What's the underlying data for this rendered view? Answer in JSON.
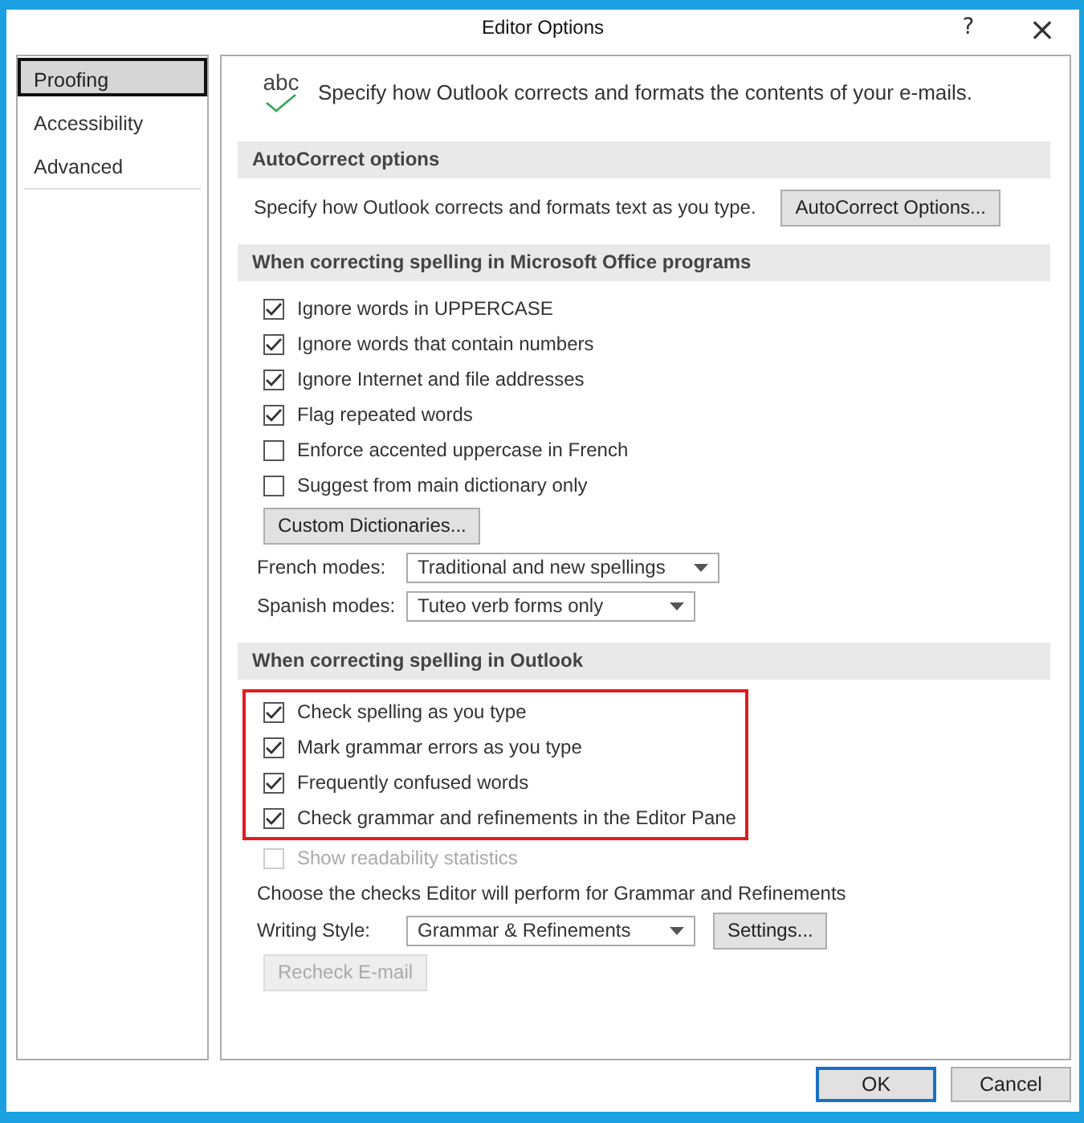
{
  "window": {
    "title": "Editor Options",
    "help": "?",
    "close": "×"
  },
  "sidebar": {
    "items": [
      {
        "label": "Proofing",
        "selected": true
      },
      {
        "label": "Accessibility",
        "selected": false
      },
      {
        "label": "Advanced",
        "selected": false
      }
    ]
  },
  "intro": {
    "icon_text": "abc",
    "text": "Specify how Outlook corrects and formats the contents of your e-mails."
  },
  "sections": [
    {
      "title": "AutoCorrect options",
      "items": [
        {
          "kind": "text_button",
          "text": "Specify how Outlook corrects and formats text as you type.",
          "button": "AutoCorrect Options..."
        }
      ]
    },
    {
      "title": "When correcting spelling in Microsoft Office programs",
      "items": [
        {
          "kind": "checkbox",
          "label": "Ignore words in UPPERCASE",
          "checked": true,
          "disabled": false,
          "highlighted": false
        },
        {
          "kind": "checkbox",
          "label": "Ignore words that contain numbers",
          "checked": true,
          "disabled": false,
          "highlighted": false
        },
        {
          "kind": "checkbox",
          "label": "Ignore Internet and file addresses",
          "checked": true,
          "disabled": false,
          "highlighted": false
        },
        {
          "kind": "checkbox",
          "label": "Flag repeated words",
          "checked": true,
          "disabled": false,
          "highlighted": false
        },
        {
          "kind": "checkbox",
          "label": "Enforce accented uppercase in French",
          "checked": false,
          "disabled": false,
          "highlighted": false
        },
        {
          "kind": "checkbox",
          "label": "Suggest from main dictionary only",
          "checked": false,
          "disabled": false,
          "highlighted": false
        },
        {
          "kind": "button",
          "label": "Custom Dictionaries...",
          "disabled": false
        },
        {
          "kind": "dropdown",
          "label": "French modes:",
          "value": "Traditional and new spellings"
        },
        {
          "kind": "dropdown",
          "label": "Spanish modes:",
          "value": "Tuteo verb forms only"
        }
      ]
    },
    {
      "title": "When correcting spelling in Outlook",
      "items": [
        {
          "kind": "checkbox",
          "label": "Check spelling as you type",
          "checked": true,
          "disabled": false,
          "highlighted": true
        },
        {
          "kind": "checkbox",
          "label": "Mark grammar errors as you type",
          "checked": true,
          "disabled": false,
          "highlighted": true
        },
        {
          "kind": "checkbox",
          "label": "Frequently confused words",
          "checked": true,
          "disabled": false,
          "highlighted": true
        },
        {
          "kind": "checkbox",
          "label": "Check grammar and refinements in the Editor Pane",
          "checked": true,
          "disabled": false,
          "highlighted": true
        },
        {
          "kind": "checkbox",
          "label": "Show readability statistics",
          "checked": false,
          "disabled": true,
          "highlighted": false
        },
        {
          "kind": "text",
          "text": "Choose the checks Editor will perform for Grammar and Refinements"
        },
        {
          "kind": "dropdown",
          "label": "Writing Style:",
          "value": "Grammar & Refinements",
          "button": "Settings..."
        },
        {
          "kind": "button",
          "label": "Recheck E-mail",
          "disabled": true
        }
      ]
    }
  ],
  "buttons": [
    {
      "label": "OK",
      "default": true
    },
    {
      "label": "Cancel",
      "default": false
    }
  ]
}
